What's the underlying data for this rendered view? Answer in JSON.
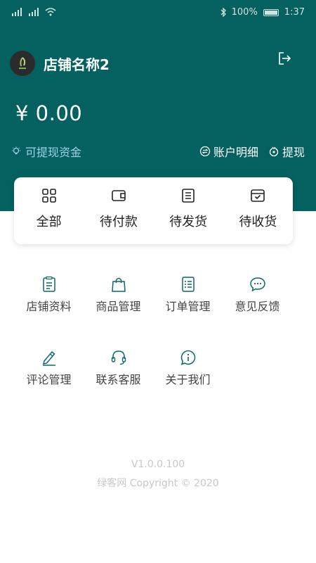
{
  "status_bar": {
    "battery": "100%",
    "time": "1:37"
  },
  "store": {
    "name": "店铺名称2"
  },
  "balance": {
    "amount": "¥ 0.00"
  },
  "withdrawable": {
    "label": "可提现资金"
  },
  "actions": {
    "account_detail": "账户明细",
    "withdraw": "提现"
  },
  "orders": [
    {
      "label": "全部",
      "icon": "grid-icon"
    },
    {
      "label": "待付款",
      "icon": "wallet-icon"
    },
    {
      "label": "待发货",
      "icon": "list-icon"
    },
    {
      "label": "待收货",
      "icon": "box-check-icon"
    }
  ],
  "menu": [
    {
      "label": "店铺资料",
      "icon": "clipboard-icon"
    },
    {
      "label": "商品管理",
      "icon": "bag-icon"
    },
    {
      "label": "订单管理",
      "icon": "order-list-icon"
    },
    {
      "label": "意见反馈",
      "icon": "chat-icon"
    },
    {
      "label": "评论管理",
      "icon": "pen-icon"
    },
    {
      "label": "联系客服",
      "icon": "headset-icon"
    },
    {
      "label": "关于我们",
      "icon": "info-icon"
    }
  ],
  "footer": {
    "version": "V1.0.0.100",
    "copyright": "绿客网 Copyright © 2020"
  },
  "colors": {
    "primary": "#04615f",
    "icon": "#0b6a66",
    "highlight": "#9fd3e3"
  }
}
